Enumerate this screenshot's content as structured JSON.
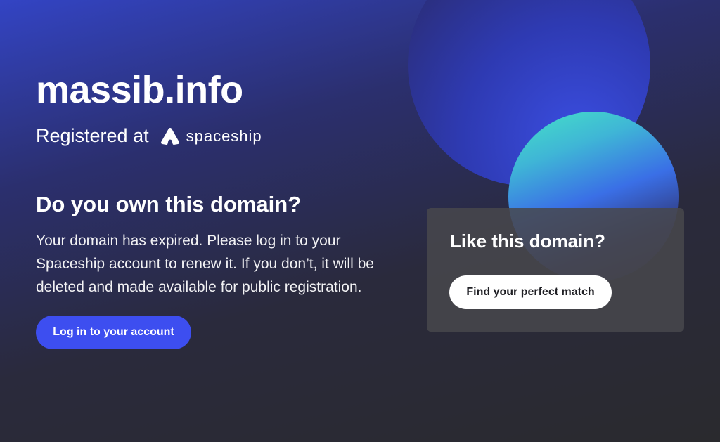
{
  "domain": {
    "name": "massib.info"
  },
  "registrar": {
    "prefix": "Registered at",
    "brand_name": "spaceship",
    "brand_icon": "spaceship-logo-icon"
  },
  "owner_section": {
    "heading": "Do you own this domain?",
    "description": "Your domain has expired. Please log in to your Spaceship account to renew it. If you don’t, it will be deleted and made available for public registration.",
    "login_label": "Log in to your account"
  },
  "promo_card": {
    "heading": "Like this domain?",
    "cta_label": "Find your perfect match"
  },
  "colors": {
    "accent": "#3d4ef0",
    "background_dark": "#2a2a2e",
    "background_blue": "#3344c4",
    "orb_teal": "#45e4c6",
    "card_background": "#48484c"
  }
}
